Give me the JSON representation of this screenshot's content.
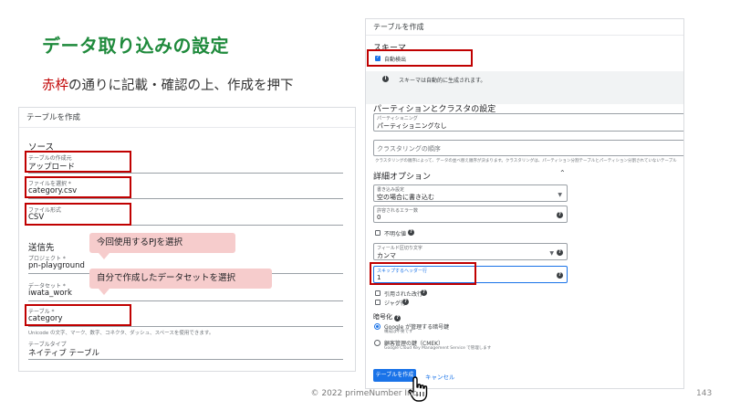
{
  "slide": {
    "title": "データ取り込みの設定",
    "subtitle_accent": "赤枠",
    "subtitle_rest": "の通りに記載・確認の上、作成を押下",
    "footer": "© 2022 primeNumber Inc.",
    "page_number": "143"
  },
  "left_panel": {
    "header": "テーブルを作成",
    "source_section": "ソース",
    "create_from_label": "テーブルの作成元",
    "create_from_value": "アップロード",
    "file_label": "ファイルを選択 *",
    "file_value": "category.csv",
    "format_label": "ファイル形式",
    "format_value": "CSV",
    "dest_section": "送信先",
    "project_label": "プロジェクト *",
    "project_value": "pn-playground",
    "dataset_label": "データセット *",
    "dataset_value": "iwata_work",
    "table_label": "テーブル *",
    "table_value": "category",
    "table_hint": "Unicode の文字、マーク、数字、コネクタ、ダッシュ、スペースを使用できます。",
    "table_type_label": "テーブルタイプ",
    "table_type_value": "ネイティブ テーブル"
  },
  "callouts": {
    "project": "今回使用するPJを選択",
    "dataset": "自分で作成したデータセットを選択"
  },
  "right_panel": {
    "header": "テーブルを作成",
    "schema_section": "スキーマ",
    "auto_detect_label": "自動検出",
    "auto_detect_checked": true,
    "schema_info": "スキーマは自動的に生成されます。",
    "partition_section": "パーティションとクラスタの設定",
    "partitioning_label": "パーティショニング",
    "partitioning_value": "パーティショニングなし",
    "clustering_placeholder": "クラスタリングの順序",
    "clustering_hint": "クラスタリングの順序によって、データの並べ替え順序が決まります。クラスタリングは、パーティション分割テーブルとパーティション分割されていないテーブル",
    "advanced_section": "詳細オプション",
    "write_pref_label": "書き込み設定",
    "write_pref_value": "空の場合に書き込む",
    "errors_label": "許容されるエラー数",
    "errors_value": "0",
    "unknown_values_label": "不明な値",
    "delimiter_label": "フィールド区切り文字",
    "delimiter_value": "カンマ",
    "skip_rows_label": "スキップするヘッダー行",
    "skip_rows_value": "1",
    "quoted_newlines_label": "引用された改行",
    "jagged_rows_label": "ジャグ行",
    "encryption_section": "暗号化",
    "google_key_label": "Google が管理する暗号鍵",
    "google_key_sub": "構成は不要です",
    "cmek_label": "顧客管理の鍵（CMEK）",
    "cmek_sub": "Google Cloud Key Management Service で管理します",
    "create_button": "テーブルを作成",
    "cancel_button": "キャンセル"
  },
  "colors": {
    "title_green": "#1f8a3c",
    "highlight_red": "#c00000",
    "callout_pink": "#f6cccc",
    "google_blue": "#1a73e8"
  }
}
